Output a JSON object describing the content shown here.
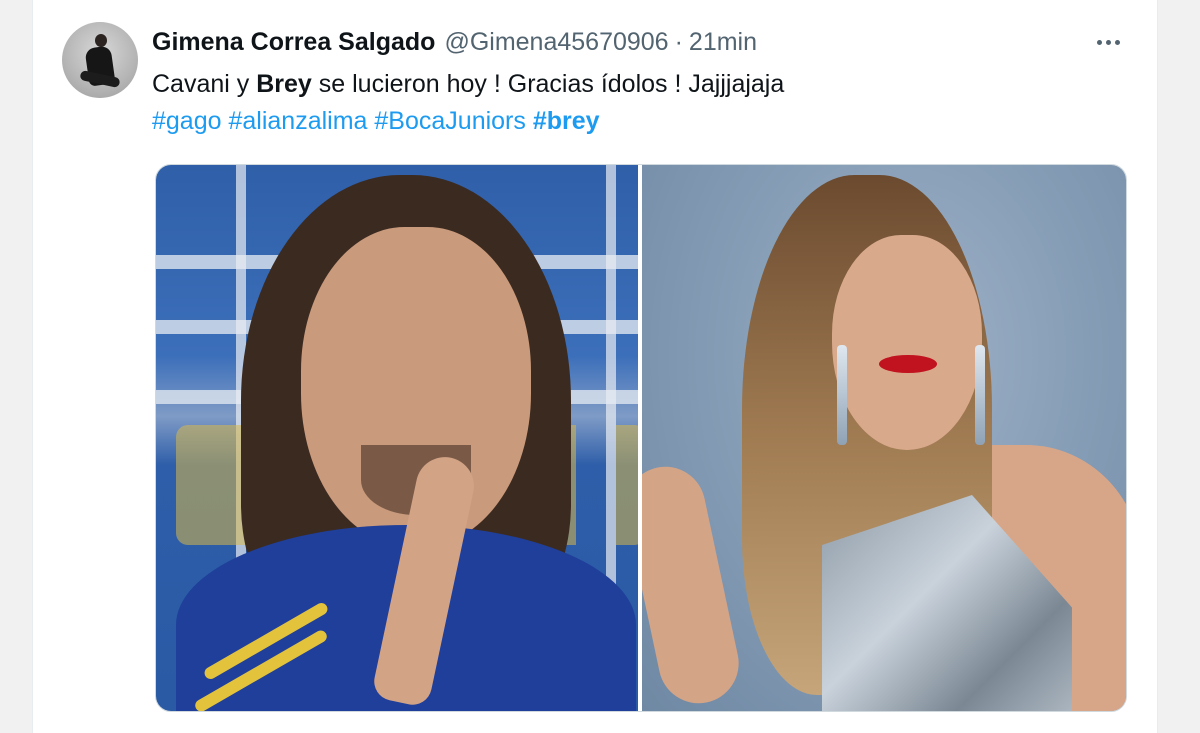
{
  "tweet": {
    "author": {
      "display_name": "Gimena Correa Salgado",
      "handle": "@Gimena45670906",
      "separator": "·",
      "time": "21min"
    },
    "more_icon": "more-horizontal-icon",
    "text": {
      "part1": "Cavani y ",
      "bold": "Brey",
      "part2": " se lucieron hoy  ! Gracias ídolos ! Jajjjajaja"
    },
    "hashtags": [
      "#gago",
      "#alianzalima",
      "#BocaJuniors",
      "#brey"
    ]
  },
  "colors": {
    "link": "#1d9bf0",
    "secondary_text": "#536471",
    "primary_text": "#0f1419"
  }
}
